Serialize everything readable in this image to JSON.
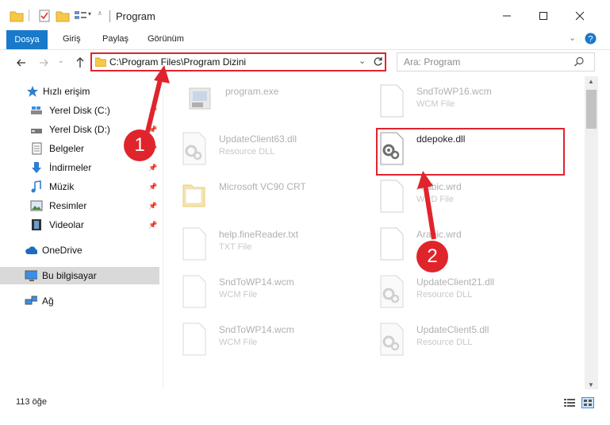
{
  "window": {
    "title": "Program"
  },
  "ribbon": {
    "tabs": [
      "Dosya",
      "Giriş",
      "Paylaş",
      "Görünüm"
    ]
  },
  "address": {
    "path": "C:\\Program Files\\Program Dizini"
  },
  "search": {
    "placeholder": "Ara: Program"
  },
  "sidebar": {
    "items": [
      {
        "label": "Hızlı erişim",
        "icon": "star-icon"
      },
      {
        "label": "Yerel Disk (C:)",
        "icon": "drive-icon"
      },
      {
        "label": "Yerel Disk (D:)",
        "icon": "drive-icon"
      },
      {
        "label": "Belgeler",
        "icon": "documents-icon"
      },
      {
        "label": "İndirmeler",
        "icon": "download-arrow-icon"
      },
      {
        "label": "Müzik",
        "icon": "music-note-icon"
      },
      {
        "label": "Resimler",
        "icon": "pictures-icon"
      },
      {
        "label": "Videolar",
        "icon": "video-film-icon"
      },
      {
        "label": "OneDrive",
        "icon": "cloud-icon"
      },
      {
        "label": "Bu bilgisayar",
        "icon": "computer-icon"
      },
      {
        "label": "Ağ",
        "icon": "network-icon"
      }
    ]
  },
  "files": [
    {
      "name": "program.exe",
      "type": ""
    },
    {
      "name": "SndToWP16.wcm",
      "type": "WCM File"
    },
    {
      "name": "UpdateClient63.dll",
      "type": "Resource DLL"
    },
    {
      "name": "ddepoke.dll",
      "type": ""
    },
    {
      "name": "Microsoft VC90 CRT",
      "type": ""
    },
    {
      "name": "Arabic.wrd",
      "type": "WRD File"
    },
    {
      "name": "help.fineReader.txt",
      "type": "TXT File"
    },
    {
      "name": "Arabic.wrd",
      "type": ""
    },
    {
      "name": "SndToWP14.wcm",
      "type": "WCM File"
    },
    {
      "name": "UpdateClient21.dll",
      "type": "Resource DLL"
    },
    {
      "name": "SndToWP14.wcm",
      "type": "WCM File"
    },
    {
      "name": "UpdateClient5.dll",
      "type": "Resource DLL"
    }
  ],
  "status": {
    "item_count": "113 öğe"
  },
  "annotations": {
    "step1": "1",
    "step2": "2"
  },
  "colors": {
    "accent": "#1979ca",
    "highlight": "#e0242c"
  }
}
